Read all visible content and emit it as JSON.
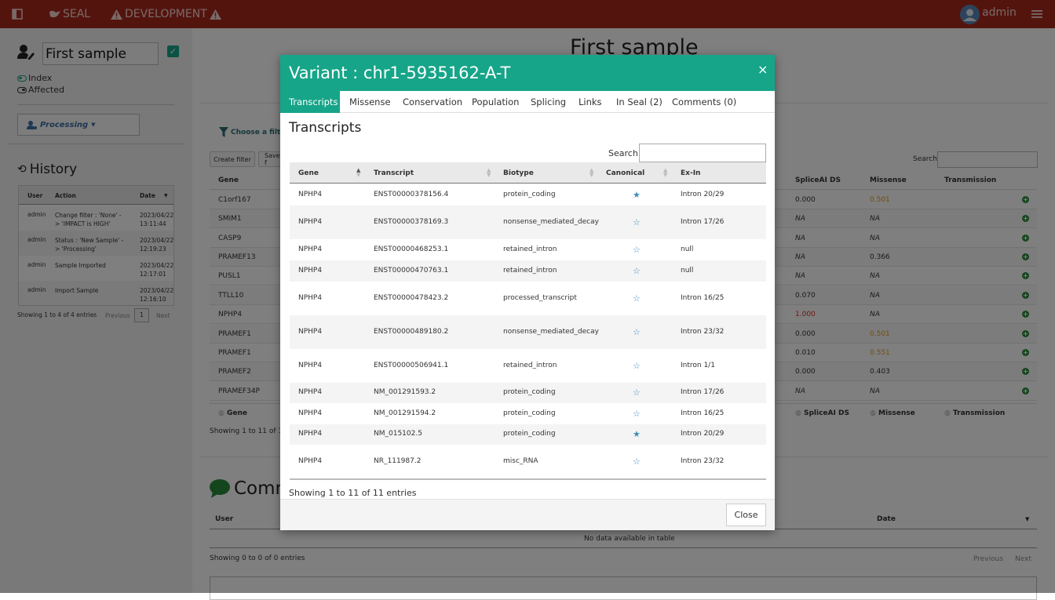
{
  "navbar": {
    "brand": "SEAL",
    "env": "DEVELOPMENT",
    "user": "admin"
  },
  "sidebar": {
    "sample_name": "First sample",
    "legend": {
      "index": "Index",
      "affected": "Affected"
    },
    "status_button": "Processing",
    "history_title": "History",
    "history_headers": [
      "User",
      "Action",
      "Date"
    ],
    "history_rows": [
      {
        "user": "admin",
        "action": "Change filter : 'None' -> 'IMPACT is HIGH'",
        "date": "2023/04/22 13:11:44"
      },
      {
        "user": "admin",
        "action": "Status : 'New Sample' -> 'Processing'",
        "date": "2023/04/22 12:19:23"
      },
      {
        "user": "admin",
        "action": "Sample Imported",
        "date": "2023/04/22 12:17:01"
      },
      {
        "user": "admin",
        "action": "Import Sample",
        "date": "2023/04/22 12:16:10"
      }
    ],
    "history_info": "Showing 1 to 4 of 4 entries",
    "pager": {
      "prev": "Previous",
      "page": "1",
      "next": "Next"
    }
  },
  "main": {
    "title": "First sample",
    "choose_filter": "Choose a filter",
    "create_filter": "Create filter",
    "save_filter": "Save f",
    "search_label": "Search:",
    "columns_left": [
      "Gene"
    ],
    "columns_right": [
      "SpliceAI DS",
      "Missense",
      "Transmission"
    ],
    "rows": [
      {
        "gene": "C1orf167",
        "splice": "0.000",
        "missense": "0.501"
      },
      {
        "gene": "SMIM1",
        "splice": "NA",
        "missense": "NA"
      },
      {
        "gene": "CASP9",
        "splice": "NA",
        "missense": "NA"
      },
      {
        "gene": "PRAMEF13",
        "splice": "NA",
        "missense": "0.366"
      },
      {
        "gene": "PUSL1",
        "splice": "NA",
        "missense": "NA"
      },
      {
        "gene": "TTLL10",
        "splice": "0.070",
        "missense": "NA"
      },
      {
        "gene": "NPHP4",
        "splice": "1.000",
        "missense": "NA"
      },
      {
        "gene": "PRAMEF1",
        "splice": "0.000",
        "missense": "0.501"
      },
      {
        "gene": "PRAMEF1",
        "splice": "0.010",
        "missense": "0.551"
      },
      {
        "gene": "PRAMEF2",
        "splice": "0.000",
        "missense": "0.403"
      },
      {
        "gene": "PRAMEF34P",
        "splice": "NA",
        "missense": "NA"
      }
    ],
    "footer_cols": {
      "gene": "Gene",
      "splice": "SpliceAI DS",
      "missense": "Missense",
      "transmission": "Transmission"
    },
    "variants_info": "Showing 1 to 11 of 11 e",
    "comments_title": "Comm",
    "comments_headers": {
      "user": "User",
      "date": "Date"
    },
    "comments_empty": "No data available in table",
    "comments_info": "Showing 0 to 0 of 0 entries",
    "comments_pager": {
      "prev": "Previous",
      "next": "Next"
    }
  },
  "modal": {
    "title": "Variant : chr1-5935162-A-T",
    "close_x": "×",
    "tabs": [
      "Transcripts",
      "Missense",
      "Conservation",
      "Population",
      "Splicing",
      "Links",
      "In Seal (2)",
      "Comments (0)"
    ],
    "section_title": "Transcripts",
    "search_label": "Search:",
    "headers": [
      "Gene",
      "Transcript",
      "Biotype",
      "Canonical",
      "Ex-In"
    ],
    "rows": [
      {
        "gene": "NPHP4",
        "transcript": "ENST00000378156.4",
        "biotype": "protein_coding",
        "canonical": true,
        "exin": "Intron 20/29"
      },
      {
        "gene": "NPHP4",
        "transcript": "ENST00000378169.3",
        "biotype": "nonsense_mediated_decay",
        "canonical": false,
        "exin": "Intron 17/26"
      },
      {
        "gene": "NPHP4",
        "transcript": "ENST00000468253.1",
        "biotype": "retained_intron",
        "canonical": false,
        "exin": "null"
      },
      {
        "gene": "NPHP4",
        "transcript": "ENST00000470763.1",
        "biotype": "retained_intron",
        "canonical": false,
        "exin": "null"
      },
      {
        "gene": "NPHP4",
        "transcript": "ENST00000478423.2",
        "biotype": "processed_transcript",
        "canonical": false,
        "exin": "Intron 16/25"
      },
      {
        "gene": "NPHP4",
        "transcript": "ENST00000489180.2",
        "biotype": "nonsense_mediated_decay",
        "canonical": false,
        "exin": "Intron 23/32"
      },
      {
        "gene": "NPHP4",
        "transcript": "ENST00000506941.1",
        "biotype": "retained_intron",
        "canonical": false,
        "exin": "Intron 1/1"
      },
      {
        "gene": "NPHP4",
        "transcript": "NM_001291593.2",
        "biotype": "protein_coding",
        "canonical": false,
        "exin": "Intron 17/26"
      },
      {
        "gene": "NPHP4",
        "transcript": "NM_001291594.2",
        "biotype": "protein_coding",
        "canonical": false,
        "exin": "Intron 16/25"
      },
      {
        "gene": "NPHP4",
        "transcript": "NM_015102.5",
        "biotype": "protein_coding",
        "canonical": true,
        "exin": "Intron 20/29"
      },
      {
        "gene": "NPHP4",
        "transcript": "NR_111987.2",
        "biotype": "misc_RNA",
        "canonical": false,
        "exin": "Intron 23/32"
      }
    ],
    "info": "Showing 1 to 11 of 11 entries",
    "close_button": "Close"
  },
  "colors": {
    "navbar": "#a8281c",
    "teal": "#17a589",
    "star": "#3c8dbc",
    "orange": "#e69a1e",
    "red": "#d9302a"
  }
}
